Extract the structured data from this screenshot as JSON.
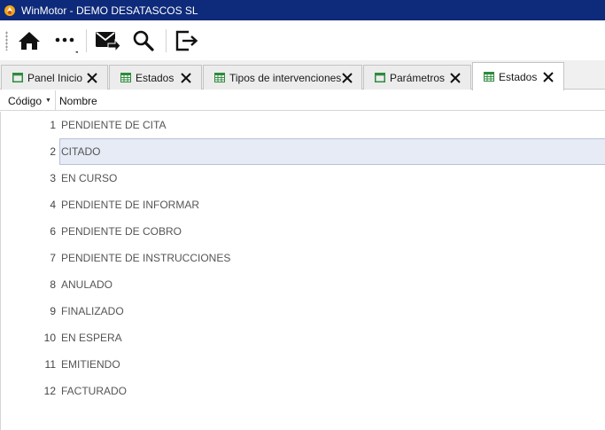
{
  "window": {
    "title": "WinMotor - DEMO DESATASCOS SL"
  },
  "toolbar": {
    "buttons": [
      {
        "name": "home",
        "icon": "home-icon"
      },
      {
        "name": "more",
        "icon": "more-icon"
      },
      {
        "name": "send-mail",
        "icon": "mail-send-icon"
      },
      {
        "name": "search",
        "icon": "search-icon"
      },
      {
        "name": "exit",
        "icon": "exit-icon"
      }
    ]
  },
  "tabs": [
    {
      "label": "Panel Inicio",
      "icon": "window-icon",
      "active": false
    },
    {
      "label": "Estados",
      "icon": "table-icon",
      "active": false
    },
    {
      "label": "Tipos de intervenciones",
      "icon": "table-icon",
      "active": false
    },
    {
      "label": "Parámetros",
      "icon": "window-icon",
      "active": false
    },
    {
      "label": "Estados",
      "icon": "table-icon",
      "active": true
    }
  ],
  "grid": {
    "columns": {
      "codigo": "Código",
      "nombre": "Nombre"
    },
    "sort_column": "codigo",
    "selected_index": 1,
    "rows": [
      {
        "codigo": "1",
        "nombre": "PENDIENTE DE CITA"
      },
      {
        "codigo": "2",
        "nombre": "CITADO"
      },
      {
        "codigo": "3",
        "nombre": "EN CURSO"
      },
      {
        "codigo": "4",
        "nombre": "PENDIENTE DE INFORMAR"
      },
      {
        "codigo": "6",
        "nombre": "PENDIENTE DE COBRO"
      },
      {
        "codigo": "7",
        "nombre": "PENDIENTE DE INSTRUCCIONES"
      },
      {
        "codigo": "8",
        "nombre": "ANULADO"
      },
      {
        "codigo": "9",
        "nombre": "FINALIZADO"
      },
      {
        "codigo": "10",
        "nombre": "EN ESPERA"
      },
      {
        "codigo": "11",
        "nombre": "EMITIENDO"
      },
      {
        "codigo": "12",
        "nombre": "FACTURADO"
      }
    ]
  },
  "colors": {
    "titlebar": "#0e2a7a",
    "tab_icon_green": "#2e8b3e",
    "selection": "#e6ebf5"
  }
}
